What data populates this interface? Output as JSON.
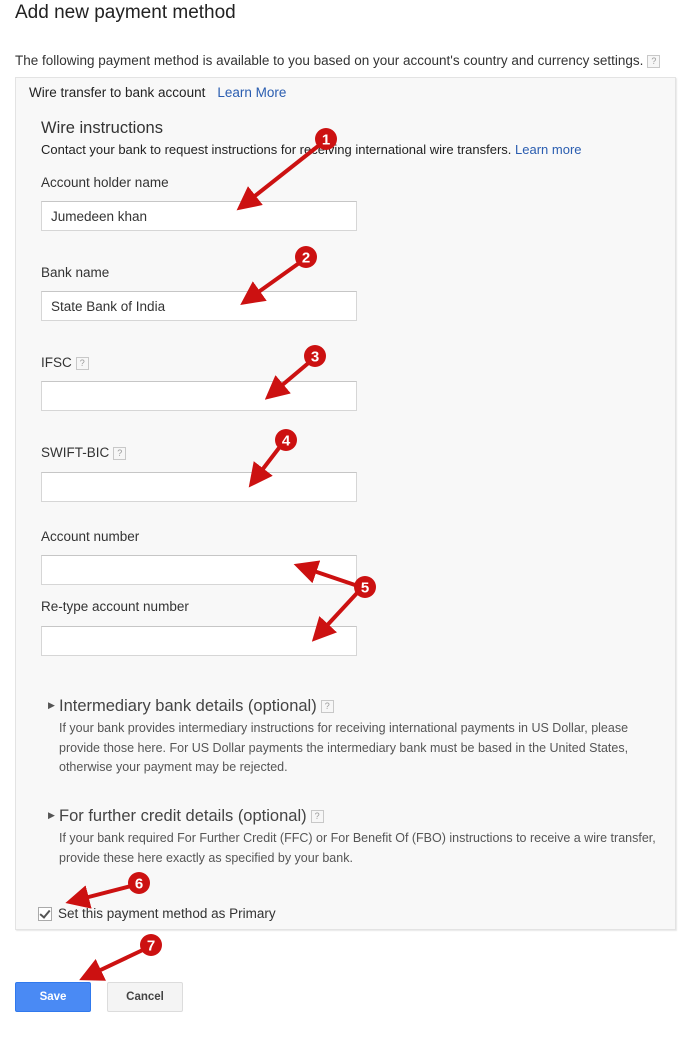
{
  "page": {
    "title": "Add new payment method",
    "intro": "The following payment method is available to you based on your account's country and currency settings.",
    "help_glyph": "?"
  },
  "method": {
    "name": "Wire transfer to bank account",
    "learn_more": "Learn More"
  },
  "wire_instructions": {
    "title": "Wire instructions",
    "subtitle": "Contact your bank to request instructions for receiving international wire transfers.",
    "learn_more": "Learn more"
  },
  "fields": {
    "account_holder": {
      "label": "Account holder name",
      "value": "Jumedeen khan"
    },
    "bank_name": {
      "label": "Bank name",
      "value": "State Bank of India"
    },
    "ifsc": {
      "label": "IFSC",
      "value": ""
    },
    "swift_bic": {
      "label": "SWIFT-BIC",
      "value": ""
    },
    "account_number": {
      "label": "Account number",
      "value": ""
    },
    "retype_account_number": {
      "label": "Re-type account number",
      "value": ""
    }
  },
  "optional_sections": {
    "intermediary": {
      "title": "Intermediary bank details (optional)",
      "description": "If your bank provides intermediary instructions for receiving international payments in US Dollar, please provide those here. For US Dollar payments the intermediary bank must be based in the United States, otherwise your payment may be rejected."
    },
    "further_credit": {
      "title": "For further credit details (optional)",
      "description": "If your bank required For Further Credit (FFC) or For Benefit Of (FBO) instructions to receive a wire transfer, provide these here exactly as specified by your bank."
    }
  },
  "primary": {
    "label": "Set this payment method as Primary",
    "checked": true
  },
  "actions": {
    "save": "Save",
    "cancel": "Cancel"
  },
  "annotations": {
    "color": "#cc1111",
    "badges": [
      "1",
      "2",
      "3",
      "4",
      "5",
      "6",
      "7"
    ]
  }
}
